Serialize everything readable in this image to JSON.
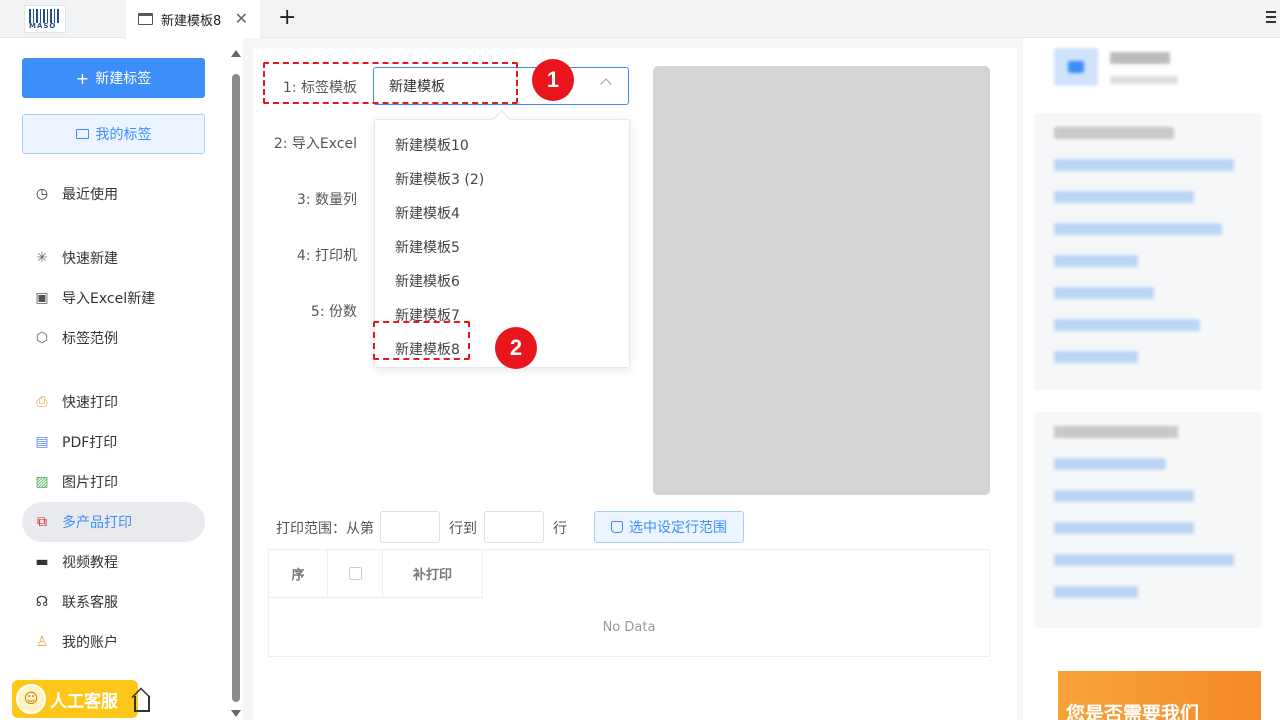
{
  "app": {
    "logo_text": "MASO"
  },
  "tabs": [
    {
      "label": "新建模板8"
    }
  ],
  "sidebar": {
    "new_label_button": "新建标签",
    "my_labels_button": "我的标签",
    "items": [
      {
        "label": "最近使用",
        "icon": "clock-icon"
      },
      {
        "label": "快速新建",
        "icon": "sparkle-icon"
      },
      {
        "label": "导入Excel新建",
        "icon": "excel-icon"
      },
      {
        "label": "标签范例",
        "icon": "box-icon"
      },
      {
        "label": "快速打印",
        "icon": "printer-icon"
      },
      {
        "label": "PDF打印",
        "icon": "pdf-icon"
      },
      {
        "label": "图片打印",
        "icon": "image-icon"
      },
      {
        "label": "多产品打印",
        "icon": "multi-print-icon",
        "active": true
      },
      {
        "label": "视频教程",
        "icon": "video-icon"
      },
      {
        "label": "联系客服",
        "icon": "headset-icon"
      },
      {
        "label": "我的账户",
        "icon": "user-icon"
      }
    ],
    "customer_service_badge": "人工客服"
  },
  "form": {
    "fields": [
      {
        "label": "1: 标签模板"
      },
      {
        "label": "2: 导入Excel"
      },
      {
        "label": "3: 数量列"
      },
      {
        "label": "4: 打印机"
      },
      {
        "label": "5: 份数"
      }
    ],
    "template_select_value": "新建模板",
    "dropdown_options": [
      "新建模板10",
      "新建模板3 (2)",
      "新建模板4",
      "新建模板5",
      "新建模板6",
      "新建模板7",
      "新建模板8"
    ]
  },
  "annotations": [
    "1",
    "2"
  ],
  "print_range": {
    "label_from": "打印范围：从第",
    "label_to": "行到",
    "label_row": "行",
    "button": "选中设定行范围"
  },
  "table": {
    "columns": [
      "序",
      "",
      "补打印"
    ],
    "empty_text": "No Data"
  },
  "promo": {
    "text": "您是否需要我们"
  },
  "colors": {
    "accent": "#3d8ef8",
    "annotation": "#e8161c",
    "badge": "#ffc61a"
  }
}
